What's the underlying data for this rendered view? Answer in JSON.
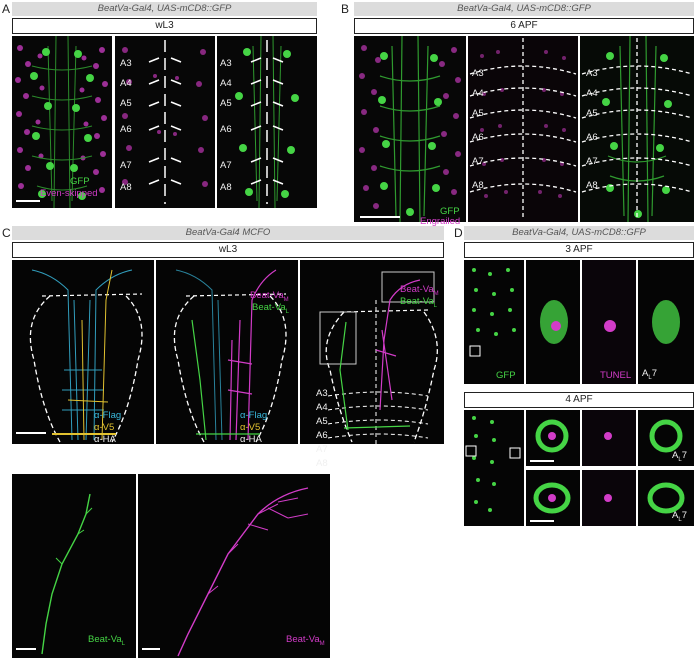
{
  "panels": {
    "A": {
      "letter": "A",
      "genotype": "BeatVa-Gal4, UAS-mCD8::GFP",
      "condition": "wL3",
      "segments": [
        "A3",
        "A4",
        "A5",
        "A6",
        "A7",
        "A8"
      ],
      "legend": {
        "gfp": "GFP",
        "marker": "Even-skipped"
      }
    },
    "B": {
      "letter": "B",
      "genotype": "BeatVa-Gal4, UAS-mCD8::GFP",
      "condition": "6 APF",
      "segments": [
        "A3",
        "A4",
        "A5",
        "A6",
        "A7",
        "A8"
      ],
      "legend": {
        "gfp": "GFP",
        "marker": "Engrailed"
      }
    },
    "C": {
      "letter": "C",
      "genotype": "BeatVa-Gal4 MCFO",
      "condition": "wL3",
      "antibodies": [
        "α-Flag",
        "α-V5",
        "α-HA"
      ],
      "cell_m": "Beat-Va",
      "cell_m_sub": "M",
      "cell_l": "Beat-Va",
      "cell_l_sub": "L",
      "segments": [
        "A3",
        "A4",
        "A5",
        "A6",
        "A7",
        "A8"
      ]
    },
    "D": {
      "letter": "D",
      "genotype": "BeatVa-Gal4, UAS-mCD8::GFP",
      "condition_1": "3 APF",
      "condition_2": "4 APF",
      "gfp": "GFP",
      "tunel": "TUNEL",
      "cell_id": "A",
      "cell_sub": "L",
      "cell_num": "7"
    }
  },
  "colors": {
    "gfp_green": "#45d445",
    "magenta": "#d23cc8",
    "cyan": "#39b8dc",
    "yellow": "#e2c230",
    "label_bar": "#dcdcdc"
  }
}
